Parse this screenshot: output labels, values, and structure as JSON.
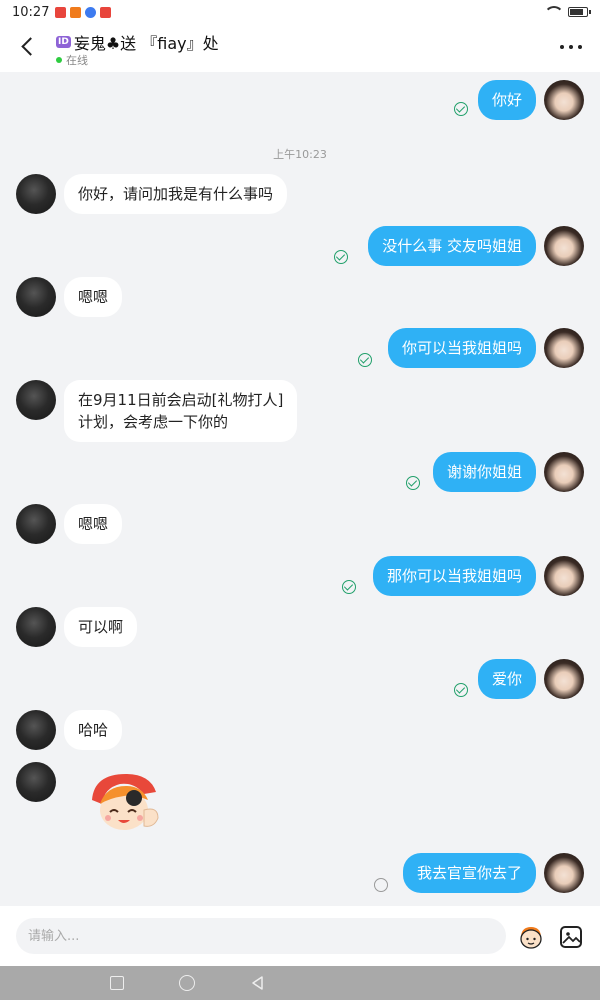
{
  "status_bar": {
    "time": "10:27",
    "notification_colors": [
      "#e8453c",
      "#f07b1c",
      "#3d7bf0",
      "#e8453c"
    ],
    "battery_fraction": 0.85
  },
  "header": {
    "id_badge": "ID",
    "title": "妄鬼♣送 『fiay』处",
    "status": "在线",
    "accent": "#2ecc40"
  },
  "messages": [
    {
      "side": "out",
      "text": "你好",
      "state": "read"
    },
    {
      "type": "time",
      "text": "上午10:23"
    },
    {
      "side": "in",
      "text": "你好，请问加我是有什么事吗"
    },
    {
      "side": "out",
      "text": "没什么事  交友吗姐姐",
      "state": "read"
    },
    {
      "side": "in",
      "text": "嗯嗯"
    },
    {
      "side": "out",
      "text": "你可以当我姐姐吗",
      "state": "read"
    },
    {
      "side": "in",
      "lines": [
        "在9月11日前会启动[礼物打人]",
        "计划，会考虑一下你的"
      ]
    },
    {
      "side": "out",
      "text": "谢谢你姐姐",
      "state": "read"
    },
    {
      "side": "in",
      "text": "嗯嗯"
    },
    {
      "side": "out",
      "text": "那你可以当我姐姐吗",
      "state": "read"
    },
    {
      "side": "in",
      "text": "可以啊"
    },
    {
      "side": "out",
      "text": "爱你",
      "state": "read"
    },
    {
      "side": "in",
      "text": "哈哈"
    },
    {
      "side": "in",
      "type": "sticker",
      "sticker": "cartoon-face-sticker"
    },
    {
      "side": "out",
      "text": "我去官宣你去了",
      "state": "pending"
    }
  ],
  "input": {
    "placeholder": "请输入..."
  },
  "colors": {
    "outgoing_bubble": "#2fb1f5",
    "incoming_bubble": "#ffffff",
    "read_check": "#22a06b"
  },
  "icons": [
    "back-arrow-icon",
    "more-dots-icon",
    "emoji-sticker-icon",
    "image-icon",
    "nav-recent-icon",
    "nav-home-icon",
    "nav-back-icon"
  ]
}
